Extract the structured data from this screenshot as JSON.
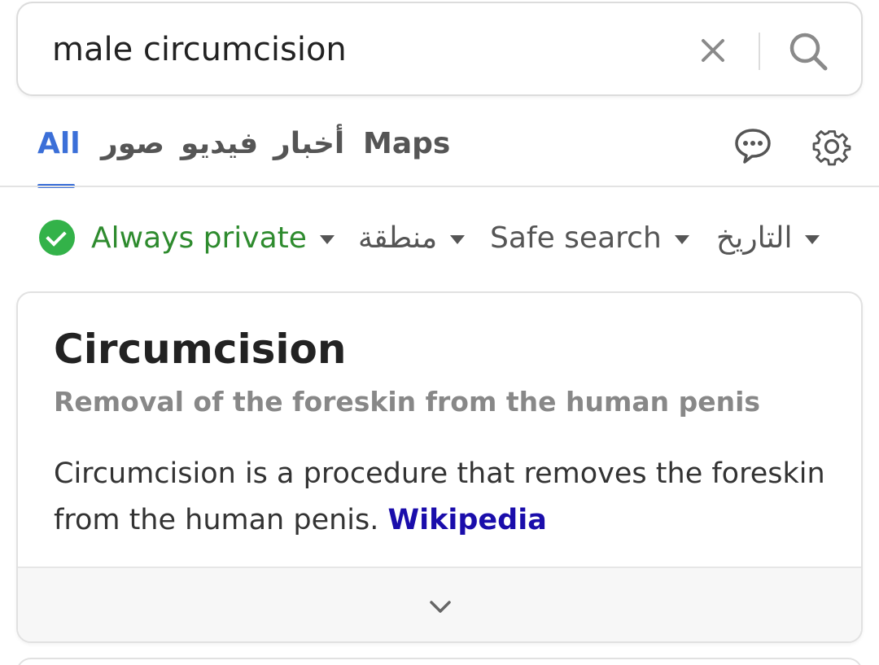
{
  "search": {
    "query": "male circumcision"
  },
  "tabs": [
    {
      "label": "All",
      "active": true
    },
    {
      "label": "صور"
    },
    {
      "label": "فيديو"
    },
    {
      "label": "أخبار"
    },
    {
      "label": "Maps"
    }
  ],
  "icons": {
    "clear": "close-icon",
    "search": "search-icon",
    "chat": "chat-bubble-icon",
    "settings": "gear-icon",
    "private": "check-circle-icon",
    "expand": "chevron-down-icon"
  },
  "filters": {
    "privacy": "Always private",
    "region": "منطقة",
    "safe_search": "Safe search",
    "date": "التاريخ"
  },
  "knowledge_panel": {
    "title": "Circumcision",
    "subtitle": "Removal of the foreskin from the human penis",
    "description": "Circumcision is a procedure that removes the foreskin from the human penis.",
    "source_link": "Wikipedia"
  },
  "colors": {
    "accent": "#3b6fd8",
    "private_green": "#2e8b2e",
    "check_green": "#33b249",
    "link": "#1a0dab"
  }
}
